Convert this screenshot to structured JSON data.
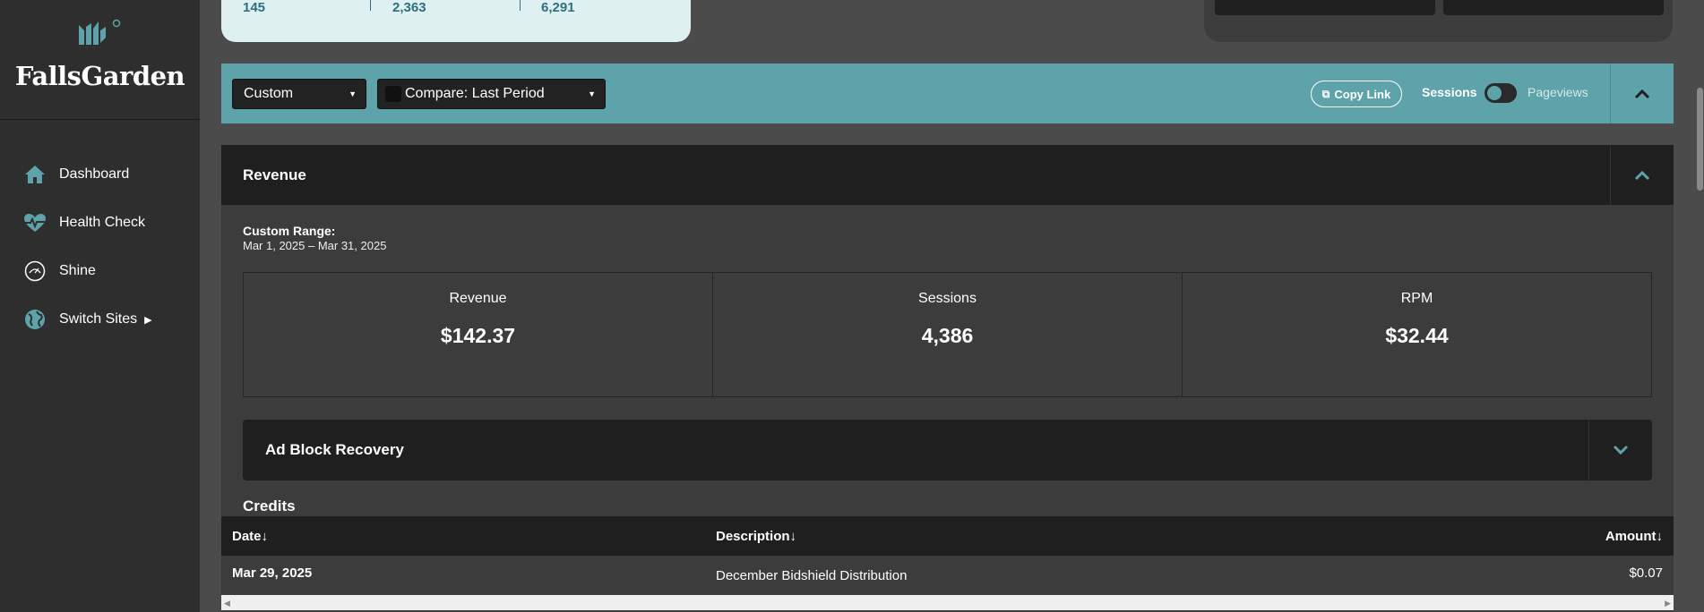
{
  "brand": {
    "name": "FallsGarden",
    "accent": "#5fa3aa"
  },
  "sidebar": {
    "items": [
      {
        "label": "Dashboard",
        "icon": "home-icon"
      },
      {
        "label": "Health Check",
        "icon": "heartbeat-icon"
      },
      {
        "label": "Shine",
        "icon": "gauge-icon"
      },
      {
        "label": "Switch Sites",
        "icon": "globe-icon",
        "has_caret": true
      }
    ]
  },
  "top_stats": [
    "145",
    "2,363",
    "6,291"
  ],
  "filters": {
    "range_select": "Custom",
    "compare_select": "Compare: Last Period",
    "copy_link": "Copy Link",
    "toggle_left": "Sessions",
    "toggle_right": "Pageviews"
  },
  "revenue": {
    "title": "Revenue",
    "range_label": "Custom Range:",
    "range_value": "Mar 1, 2025 – Mar 31, 2025",
    "metrics": [
      {
        "label": "Revenue",
        "value": "$142.37"
      },
      {
        "label": "Sessions",
        "value": "4,386"
      },
      {
        "label": "RPM",
        "value": "$32.44"
      }
    ],
    "ad_block": "Ad Block Recovery",
    "credits_title": "Credits",
    "table": {
      "headers": {
        "date": "Date↓",
        "description": "Description↓",
        "amount": "Amount↓"
      },
      "rows": [
        {
          "date": "Mar 29, 2025",
          "description": "December Bidshield Distribution",
          "amount": "$0.07"
        }
      ]
    }
  }
}
